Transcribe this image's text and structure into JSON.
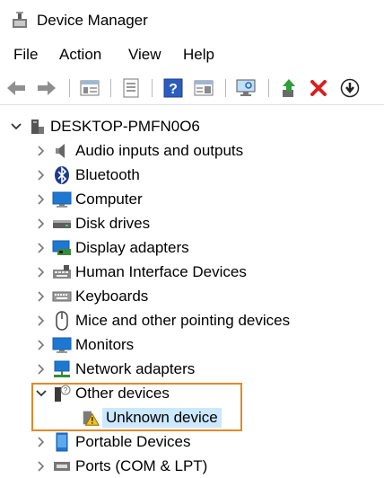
{
  "window": {
    "title": "Device Manager",
    "icon": "device-manager-icon"
  },
  "menu": {
    "items": [
      "File",
      "Action",
      "View",
      "Help"
    ]
  },
  "toolbar": {
    "buttons": [
      "back-arrow-icon",
      "forward-arrow-icon",
      "properties-icon",
      "show-hide-tree-icon",
      "help-icon",
      "action-pane-icon",
      "monitor-scan-icon",
      "update-driver-icon",
      "uninstall-icon",
      "disable-device-icon"
    ]
  },
  "tree": {
    "root": "DESKTOP-PMFN0O6",
    "categories": [
      {
        "label": "Audio inputs and outputs",
        "icon": "speaker-icon"
      },
      {
        "label": "Bluetooth",
        "icon": "bluetooth-icon"
      },
      {
        "label": "Computer",
        "icon": "computer-icon"
      },
      {
        "label": "Disk drives",
        "icon": "disk-drive-icon"
      },
      {
        "label": "Display adapters",
        "icon": "display-adapter-icon"
      },
      {
        "label": "Human Interface Devices",
        "icon": "hid-icon"
      },
      {
        "label": "Keyboards",
        "icon": "keyboard-icon"
      },
      {
        "label": "Mice and other pointing devices",
        "icon": "mouse-icon"
      },
      {
        "label": "Monitors",
        "icon": "monitor-icon"
      },
      {
        "label": "Network adapters",
        "icon": "network-adapter-icon"
      },
      {
        "label": "Other devices",
        "icon": "other-devices-icon",
        "expanded": true
      },
      {
        "label": "Unknown device",
        "icon": "unknown-device-warning-icon",
        "child": true,
        "selected": true
      },
      {
        "label": "Portable Devices",
        "icon": "portable-device-icon"
      },
      {
        "label": "Ports (COM & LPT)",
        "icon": "ports-icon"
      }
    ]
  },
  "colors": {
    "highlight_border": "#e08a2a",
    "selection": "#cce8ff",
    "accent_blue": "#1e78d2",
    "delete_red": "#d7201f"
  }
}
